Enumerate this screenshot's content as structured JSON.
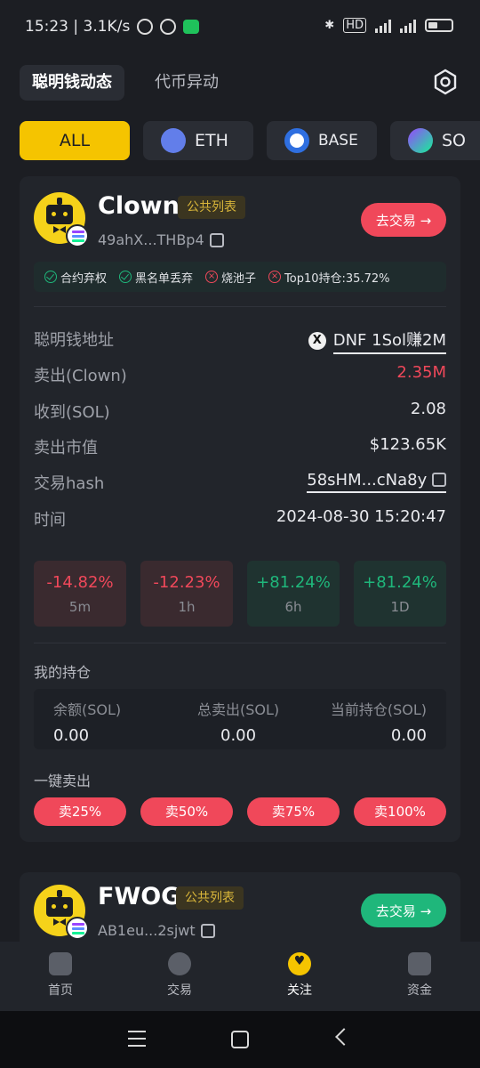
{
  "status": {
    "time_net": "15:23 | 3.1K/s",
    "right_label": "HD"
  },
  "topnav": {
    "tab_active": "聪明钱动态",
    "tab_other": "代币异动"
  },
  "chips": [
    "ALL",
    "ETH",
    "BASE",
    "SO"
  ],
  "card1": {
    "name": "Clown",
    "tag": "公共列表",
    "address": "49ahX...THBp4",
    "trade_label": "去交易 →",
    "checks": [
      "合约弃权",
      "黑名单丢弃",
      "烧池子",
      "Top10持仓:35.72%"
    ],
    "rows": [
      {
        "label": "聪明钱地址",
        "value": "DNF 1Sol赚2M"
      },
      {
        "label": "卖出(Clown)",
        "value": "2.35M"
      },
      {
        "label": "收到(SOL)",
        "value": "2.08"
      },
      {
        "label": "卖出市值",
        "value": "$123.65K"
      },
      {
        "label": "交易hash",
        "value": "58sHM...cNa8y"
      },
      {
        "label": "时间",
        "value": "2024-08-30 15:20:47"
      }
    ],
    "changes": [
      {
        "value": "-14.82%",
        "period": "5m"
      },
      {
        "value": "-12.23%",
        "period": "1h"
      },
      {
        "value": "+81.24%",
        "period": "6h"
      },
      {
        "value": "+81.24%",
        "period": "1D"
      }
    ],
    "holdings_title": "我的持仓",
    "holdings": [
      {
        "label": "余额(SOL)",
        "value": "0.00"
      },
      {
        "label": "总卖出(SOL)",
        "value": "0.00"
      },
      {
        "label": "当前持仓(SOL)",
        "value": "0.00"
      }
    ],
    "sell_title": "一键卖出",
    "sell_buttons": [
      "卖25%",
      "卖50%",
      "卖75%",
      "卖100%"
    ]
  },
  "card2": {
    "name": "FWOG",
    "tag": "公共列表",
    "address": "AB1eu...2sjwt",
    "trade_label": "去交易 →"
  },
  "tabbar": [
    "首页",
    "交易",
    "关注",
    "资金"
  ],
  "colors": {
    "accent": "#f5c400",
    "sell_red": "#f0485a",
    "buy_green": "#1fb77b"
  }
}
